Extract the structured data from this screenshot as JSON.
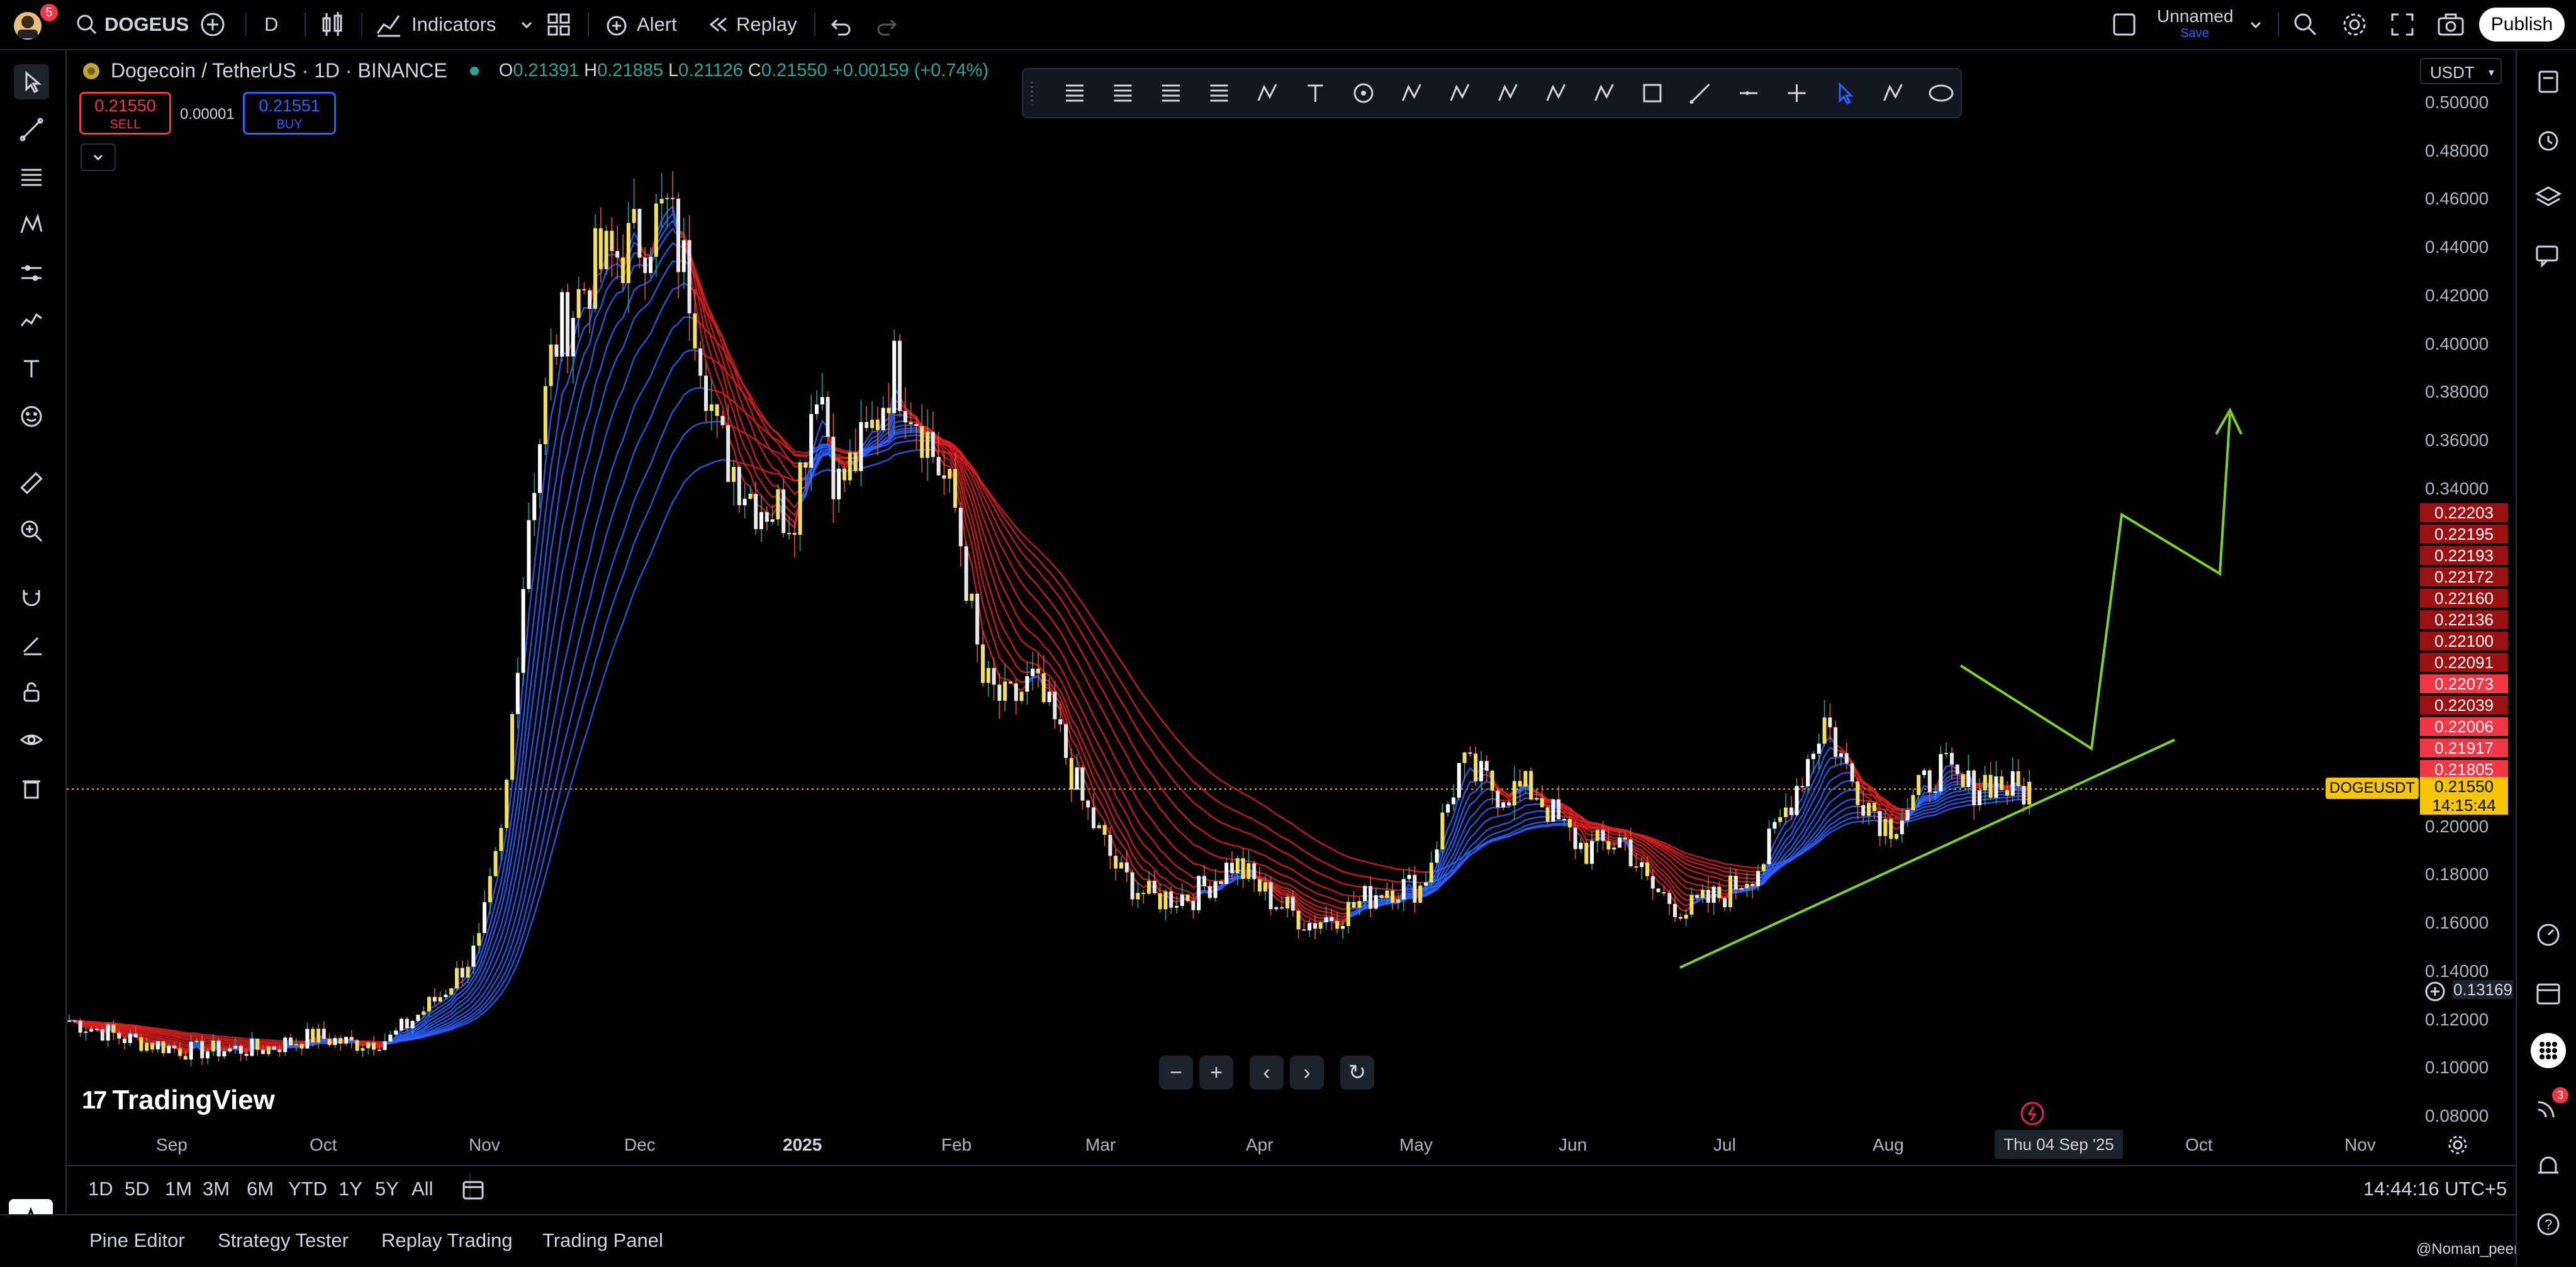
{
  "topbar": {
    "avatar_badge": "5",
    "symbol": "DOGEUS",
    "interval": "D",
    "indicators_label": "Indicators",
    "alert_label": "Alert",
    "replay_label": "Replay",
    "layout_name": "Unnamed",
    "layout_save": "Save",
    "publish_label": "Publish"
  },
  "legend": {
    "title": "Dogecoin / TetherUS · 1D · BINANCE",
    "o_label": "O",
    "o_value": "0.21391",
    "h_label": "H",
    "h_value": "0.21885",
    "l_label": "L",
    "l_value": "0.21126",
    "c_label": "C",
    "c_value": "0.21550",
    "change": "+0.00159 (+0.74%)",
    "sell_price": "0.21550",
    "sell_label": "SELL",
    "spread": "0.00001",
    "buy_price": "0.21551",
    "buy_label": "BUY"
  },
  "price_axis": {
    "currency": "USDT",
    "labels": [
      "0.50000",
      "0.48000",
      "0.46000",
      "0.44000",
      "0.42000",
      "0.40000",
      "0.38000",
      "0.36000",
      "0.34000",
      "0.20000",
      "0.18000",
      "0.16000",
      "0.14000",
      "0.12000",
      "0.10000",
      "0.08000"
    ],
    "ribbon_tags": [
      "0.22203",
      "0.22195",
      "0.22193",
      "0.22172",
      "0.22160",
      "0.22136",
      "0.22100",
      "0.22091",
      "0.22073",
      "0.22039",
      "0.22006",
      "0.21917",
      "0.21805"
    ],
    "symbol_tag": "DOGEUSDT",
    "last_price": "0.21550",
    "countdown": "14:15:44",
    "crosshair_price": "0.13169"
  },
  "time_axis": {
    "labels": [
      "Sep",
      "Oct",
      "Nov",
      "Dec",
      "2025",
      "Feb",
      "Mar",
      "Apr",
      "May",
      "Jun",
      "Jul",
      "Aug",
      "Oct",
      "Nov"
    ],
    "crosshair_date": "Thu 04 Sep '25"
  },
  "watermark": "TradingView",
  "bottom_ranges": [
    "1D",
    "5D",
    "1M",
    "3M",
    "6M",
    "YTD",
    "1Y",
    "5Y",
    "All"
  ],
  "clock": "14:44:16 UTC+5",
  "footer_tabs": [
    "Pine Editor",
    "Strategy Tester",
    "Replay Trading",
    "Trading Panel"
  ],
  "footer_user": "@Noman_peerzada",
  "notification_badge": "3",
  "colors": {
    "up": "#26a69a",
    "down": "#ef5350",
    "bull_ribbon": "#2962ff",
    "bear_ribbon": "#e02020",
    "trend": "#7ed321",
    "candle_yellow": "#f5e05a",
    "price_tag": "#f7c600"
  }
}
